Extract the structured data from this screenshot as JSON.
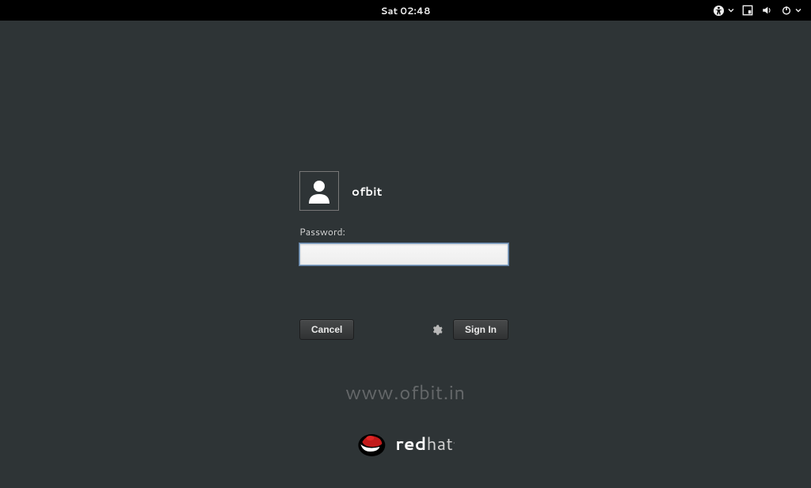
{
  "topbar": {
    "clock": "Sat 02:48"
  },
  "login": {
    "username": "ofbit",
    "password_label": "Password:",
    "password_value": "",
    "cancel_label": "Cancel",
    "signin_label": "Sign In"
  },
  "watermark": "www.ofbit.in",
  "brand": {
    "bold": "red",
    "light": "hat",
    "tm": "."
  }
}
